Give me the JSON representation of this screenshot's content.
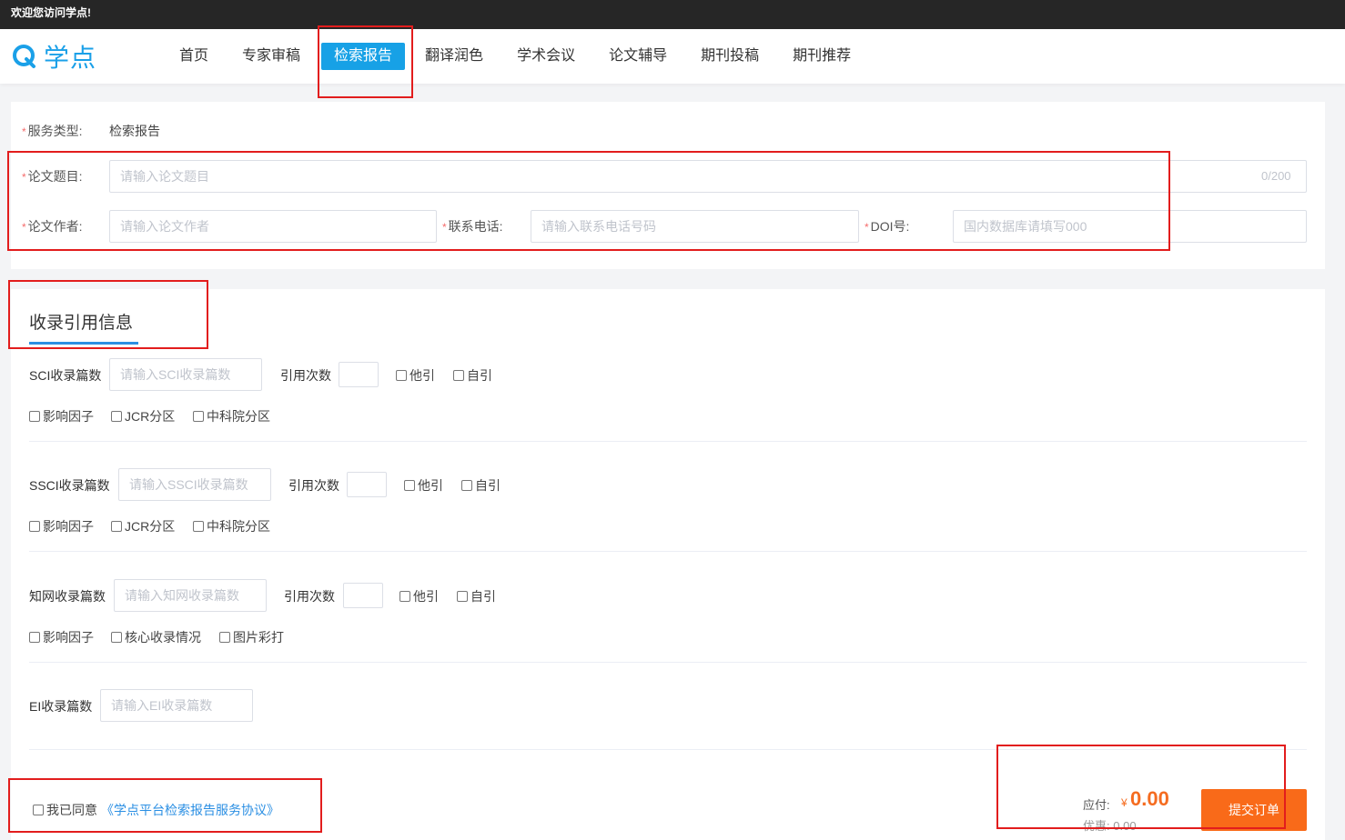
{
  "topbar": {
    "welcome": "欢迎您访问学点!"
  },
  "header": {
    "logo_text": "学点",
    "nav": [
      "首页",
      "专家审稿",
      "检索报告",
      "翻译润色",
      "学术会议",
      "论文辅导",
      "期刊投稿",
      "期刊推荐"
    ],
    "active_index": 2
  },
  "form": {
    "required_mark": "*",
    "service_type_label": "服务类型:",
    "service_type_value": "检索报告",
    "title_label": "论文题目:",
    "title_placeholder": "请输入论文题目",
    "title_counter": "0/200",
    "author_label": "论文作者:",
    "author_placeholder": "请输入论文作者",
    "phone_label": "联系电话:",
    "phone_placeholder": "请输入联系电话号码",
    "doi_label": "DOI号:",
    "doi_placeholder": "国内数据库请填写000"
  },
  "citation": {
    "title": "收录引用信息",
    "cite_count_label": "引用次数",
    "other_cite": "他引",
    "self_cite": "自引",
    "sci": {
      "label": "SCI收录篇数",
      "placeholder": "请输入SCI收录篇数",
      "options": [
        "影响因子",
        "JCR分区",
        "中科院分区"
      ]
    },
    "ssci": {
      "label": "SSCI收录篇数",
      "placeholder": "请输入SSCI收录篇数",
      "options": [
        "影响因子",
        "JCR分区",
        "中科院分区"
      ]
    },
    "cnki": {
      "label": "知网收录篇数",
      "placeholder": "请输入知网收录篇数",
      "options": [
        "影响因子",
        "核心收录情况",
        "图片彩打"
      ]
    },
    "ei": {
      "label": "EI收录篇数",
      "placeholder": "请输入EI收录篇数"
    }
  },
  "footer": {
    "agree_text": "我已同意",
    "agreement_link": "《学点平台检索报告服务协议》",
    "pay_label": "应付:",
    "currency": "¥",
    "pay_amount": "0.00",
    "discount_label": "优惠:",
    "discount_amount": "0.00",
    "submit_label": "提交订单"
  },
  "colors": {
    "brand": "#1aa0e8",
    "nav_active": "#17a1e6",
    "price": "#f56c20",
    "submit": "#f96a19",
    "highlight": "#e21d1d"
  }
}
